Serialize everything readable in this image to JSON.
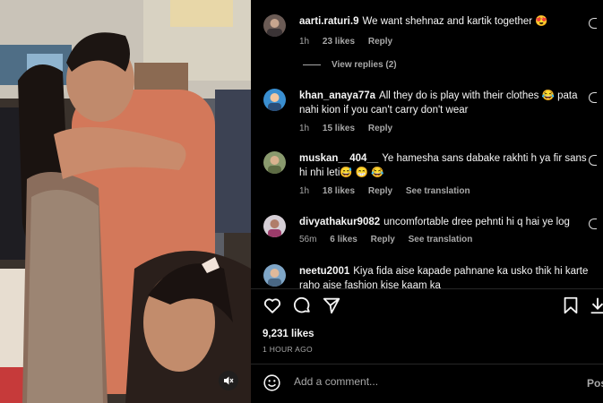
{
  "comments": [
    {
      "username": "aarti.raturi.9",
      "text": "We want shehnaz and kartik together 😍",
      "time": "1h",
      "likes": "23 likes",
      "reply": "Reply",
      "translate": ""
    },
    {
      "username": "khan_anaya77a",
      "text": "All they do is play with their clothes 😂 pata nahi kion if you can't carry don't wear",
      "time": "1h",
      "likes": "15 likes",
      "reply": "Reply",
      "translate": ""
    },
    {
      "username": "muskan__404__",
      "text": "Ye hamesha sans dabake rakhti h ya fir sans hi nhi leti😅 😁 😂",
      "time": "1h",
      "likes": "18 likes",
      "reply": "Reply",
      "translate": "See translation"
    },
    {
      "username": "divyathakur9082",
      "text": "uncomfortable dree pehnti hi q hai ye log",
      "time": "56m",
      "likes": "6 likes",
      "reply": "Reply",
      "translate": "See translation"
    },
    {
      "username": "neetu2001",
      "text": "Kiya fida aise kapade pahnane ka usko thik hi karte raho aise fashion kise kaam ka",
      "time": "",
      "likes": "",
      "reply": "",
      "translate": ""
    }
  ],
  "view_replies": "View replies (2)",
  "post": {
    "likes": "9,231 likes",
    "time_ago": "1 HOUR AGO"
  },
  "add_comment": {
    "placeholder": "Add a comment...",
    "post_label": "Pos"
  },
  "icons": {
    "like": "heart-icon",
    "comment": "comment-icon",
    "share": "share-icon",
    "save": "bookmark-icon",
    "download": "download-icon",
    "mute": "muted-speaker-icon",
    "emoji": "emoji-icon"
  }
}
